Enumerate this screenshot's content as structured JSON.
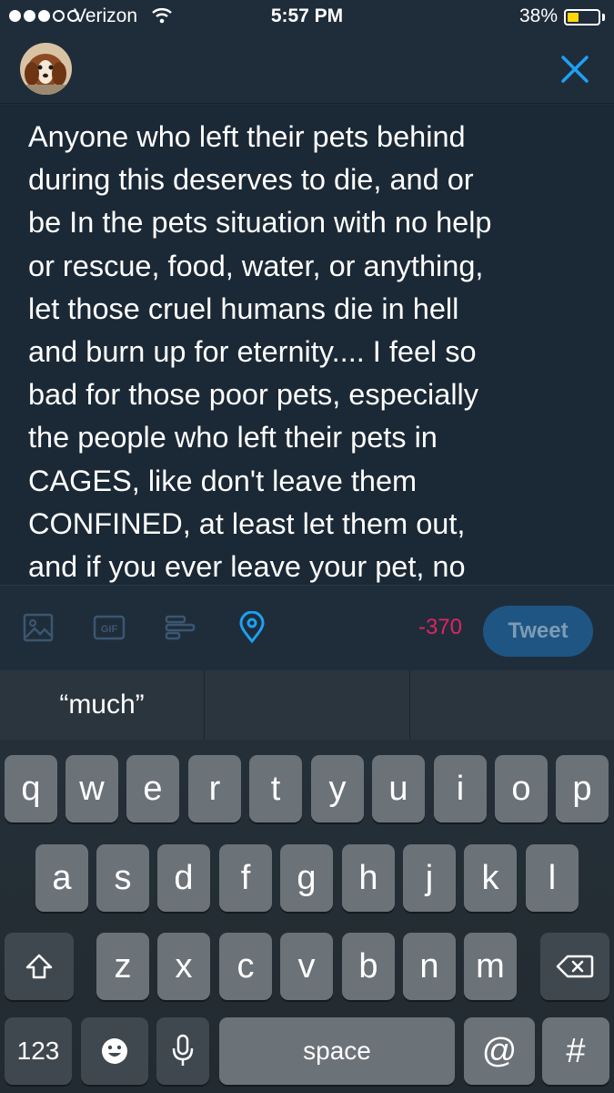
{
  "status_bar": {
    "carrier": "Verizon",
    "time": "5:57 PM",
    "battery_percent": "38%",
    "battery_level": 0.38,
    "signal_bars_filled": 3,
    "signal_bars_total": 5
  },
  "compose": {
    "text": "Anyone who left their pets behind\nduring this deserves to die, and or\nbe In the pets situation with no help\nor rescue, food, water, or anything,\nlet those cruel humans die in hell\nand burn up for eternity.... I feel so\nbad for those poor pets, especially\nthe people who left their pets in\nCAGES, like don't leave them\nCONFINED, at least let them out,\nand if you ever leave your pet, no"
  },
  "toolbar": {
    "counter": "-370",
    "tweet_label": "Tweet",
    "icons": [
      "image-icon",
      "gif-icon",
      "poll-icon",
      "location-icon"
    ]
  },
  "keyboard": {
    "suggestions": [
      "“much”",
      "",
      ""
    ],
    "row1": [
      "q",
      "w",
      "e",
      "r",
      "t",
      "y",
      "u",
      "i",
      "o",
      "p"
    ],
    "row2": [
      "a",
      "s",
      "d",
      "f",
      "g",
      "h",
      "j",
      "k",
      "l"
    ],
    "row3": [
      "z",
      "x",
      "c",
      "v",
      "b",
      "n",
      "m"
    ],
    "numbers_label": "123",
    "space_label": "space",
    "at_label": "@",
    "hash_label": "#"
  },
  "colors": {
    "accent": "#1da1f2",
    "counter_over": "#e0245e",
    "background": "#1f2d3b"
  }
}
